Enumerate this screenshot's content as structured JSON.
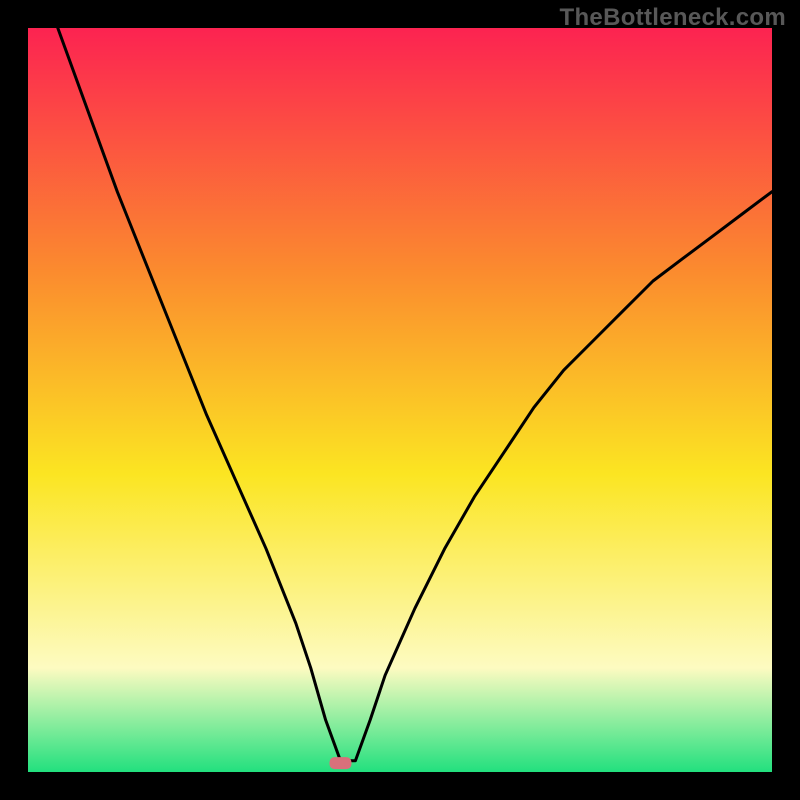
{
  "watermark": "TheBottleneck.com",
  "chart_data": {
    "type": "line",
    "title": "",
    "xlabel": "",
    "ylabel": "",
    "xlim": [
      0,
      100
    ],
    "ylim": [
      0,
      100
    ],
    "grid": false,
    "legend": false,
    "background_gradient": {
      "top": "#fc2351",
      "upper_mid": "#fb8c2e",
      "mid": "#fbe522",
      "lower_mid": "#fdfbc1",
      "bottom": "#22e07e"
    },
    "marker": {
      "x": 42,
      "y": 1.2,
      "color": "#d9707b",
      "shape": "rounded-rect"
    },
    "series": [
      {
        "name": "curve",
        "x": [
          4,
          8,
          12,
          16,
          20,
          24,
          28,
          32,
          36,
          38,
          40,
          42,
          44,
          46,
          48,
          52,
          56,
          60,
          64,
          68,
          72,
          76,
          80,
          84,
          88,
          92,
          96,
          100
        ],
        "y": [
          100,
          89,
          78,
          68,
          58,
          48,
          39,
          30,
          20,
          14,
          7,
          1.5,
          1.5,
          7,
          13,
          22,
          30,
          37,
          43,
          49,
          54,
          58,
          62,
          66,
          69,
          72,
          75,
          78
        ]
      }
    ]
  }
}
